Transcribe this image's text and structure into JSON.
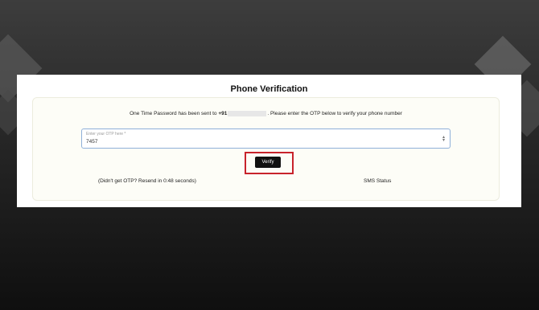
{
  "page": {
    "title": "Phone Verification"
  },
  "message": {
    "prefix": "One Time Password has been sent to",
    "phone_prefix": "+91",
    "suffix": ". Please enter the OTP below to verify your phone number"
  },
  "otp": {
    "label": "Enter your OTP here *",
    "value": "7457"
  },
  "verify": {
    "label": "Verify"
  },
  "resend": {
    "text": "(Didn't get OTP? Resend in 0:48 seconds)"
  },
  "sms": {
    "status_label": "SMS Status"
  },
  "colors": {
    "highlight": "#c8232c",
    "button": "#111111",
    "field_border": "#8fb0d9"
  },
  "icons": {
    "spinner": "number-spinner-icon"
  }
}
